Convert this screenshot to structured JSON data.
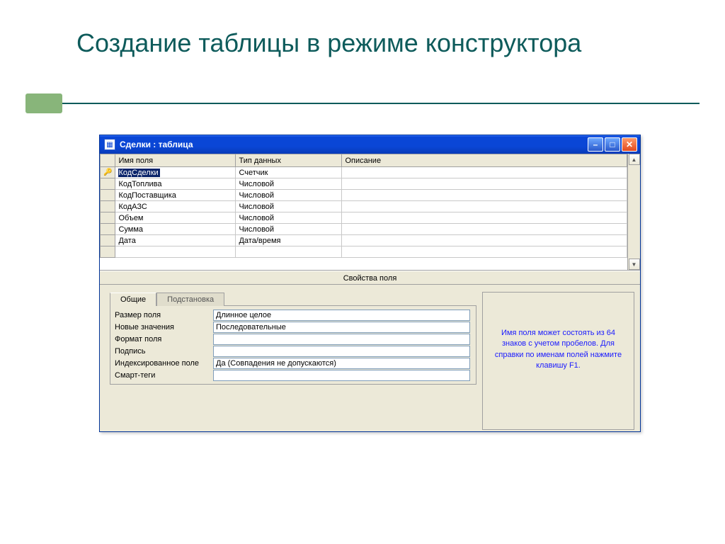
{
  "slide": {
    "title": "Создание таблицы в режиме конструктора"
  },
  "window": {
    "title": "Сделки : таблица"
  },
  "grid": {
    "headers": {
      "name": "Имя поля",
      "type": "Тип данных",
      "desc": "Описание"
    },
    "rows": [
      {
        "key": true,
        "name": "КодСделки",
        "type": "Счетчик",
        "desc": ""
      },
      {
        "key": false,
        "name": "КодТоплива",
        "type": "Числовой",
        "desc": ""
      },
      {
        "key": false,
        "name": "КодПоставщика",
        "type": "Числовой",
        "desc": ""
      },
      {
        "key": false,
        "name": "КодАЗС",
        "type": "Числовой",
        "desc": ""
      },
      {
        "key": false,
        "name": "Объем",
        "type": "Числовой",
        "desc": ""
      },
      {
        "key": false,
        "name": "Сумма",
        "type": "Числовой",
        "desc": ""
      },
      {
        "key": false,
        "name": "Дата",
        "type": "Дата/время",
        "desc": ""
      }
    ]
  },
  "properties": {
    "section_title": "Свойства поля",
    "tabs": {
      "general": "Общие",
      "lookup": "Подстановка"
    },
    "rows": [
      {
        "label": "Размер поля",
        "value": "Длинное целое"
      },
      {
        "label": "Новые значения",
        "value": "Последовательные"
      },
      {
        "label": "Формат поля",
        "value": ""
      },
      {
        "label": "Подпись",
        "value": ""
      },
      {
        "label": "Индексированное поле",
        "value": "Да (Совпадения не допускаются)"
      },
      {
        "label": "Смарт-теги",
        "value": ""
      }
    ],
    "help": "Имя поля может состоять из 64 знаков с учетом пробелов.  Для справки по именам полей нажмите клавишу F1."
  }
}
